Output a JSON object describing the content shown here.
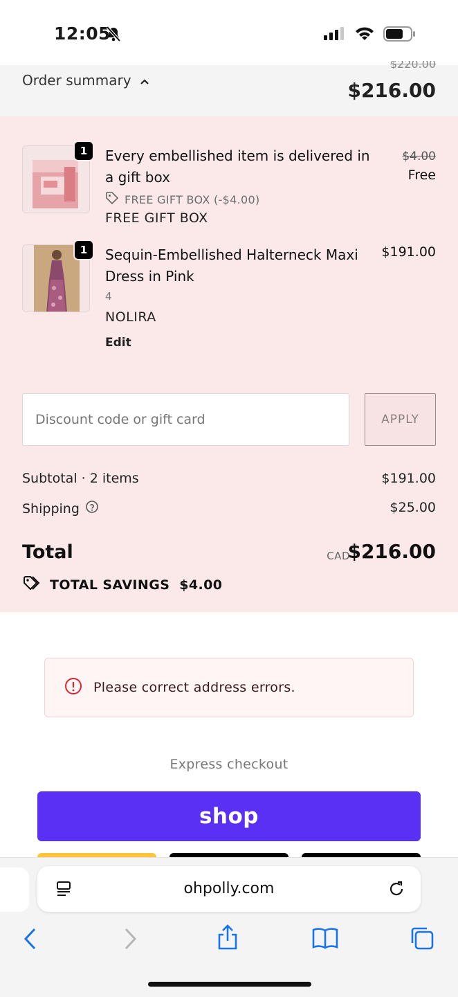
{
  "status_bar": {
    "time": "12:05"
  },
  "summary_header": {
    "toggle_label": "Order summary",
    "original_total": "$220.00",
    "total": "$216.00"
  },
  "items": [
    {
      "quantity": "1",
      "title": "Every embellished item is delivered in a gift box",
      "original_price": "$4.00",
      "price": "Free",
      "discount": "FREE GIFT BOX (-$4.00)",
      "meta": "FREE GIFT BOX"
    },
    {
      "quantity": "1",
      "title": "Sequin-Embellished Halterneck Maxi Dress in Pink",
      "price": "$191.00",
      "variant": "4",
      "meta": "NOLIRA",
      "edit_label": "Edit"
    }
  ],
  "discount_field": {
    "placeholder": "Discount code or gift card",
    "apply_label": "APPLY"
  },
  "totals": {
    "subtotal_label": "Subtotal · 2 items",
    "subtotal_value": "$191.00",
    "shipping_label": "Shipping",
    "shipping_value": "$25.00",
    "total_label": "Total",
    "currency": "CAD",
    "total_value": "$216.00",
    "savings_label": "TOTAL SAVINGS",
    "savings_value": "$4.00"
  },
  "error": {
    "message": "Please correct address errors."
  },
  "express": {
    "label": "Express checkout",
    "shop_label": "shop"
  },
  "browser": {
    "url": "ohpolly.com"
  },
  "colors": {
    "panel": "#fbe9e9",
    "shop_purple": "#5a31f4",
    "error_red": "#d4262e"
  }
}
